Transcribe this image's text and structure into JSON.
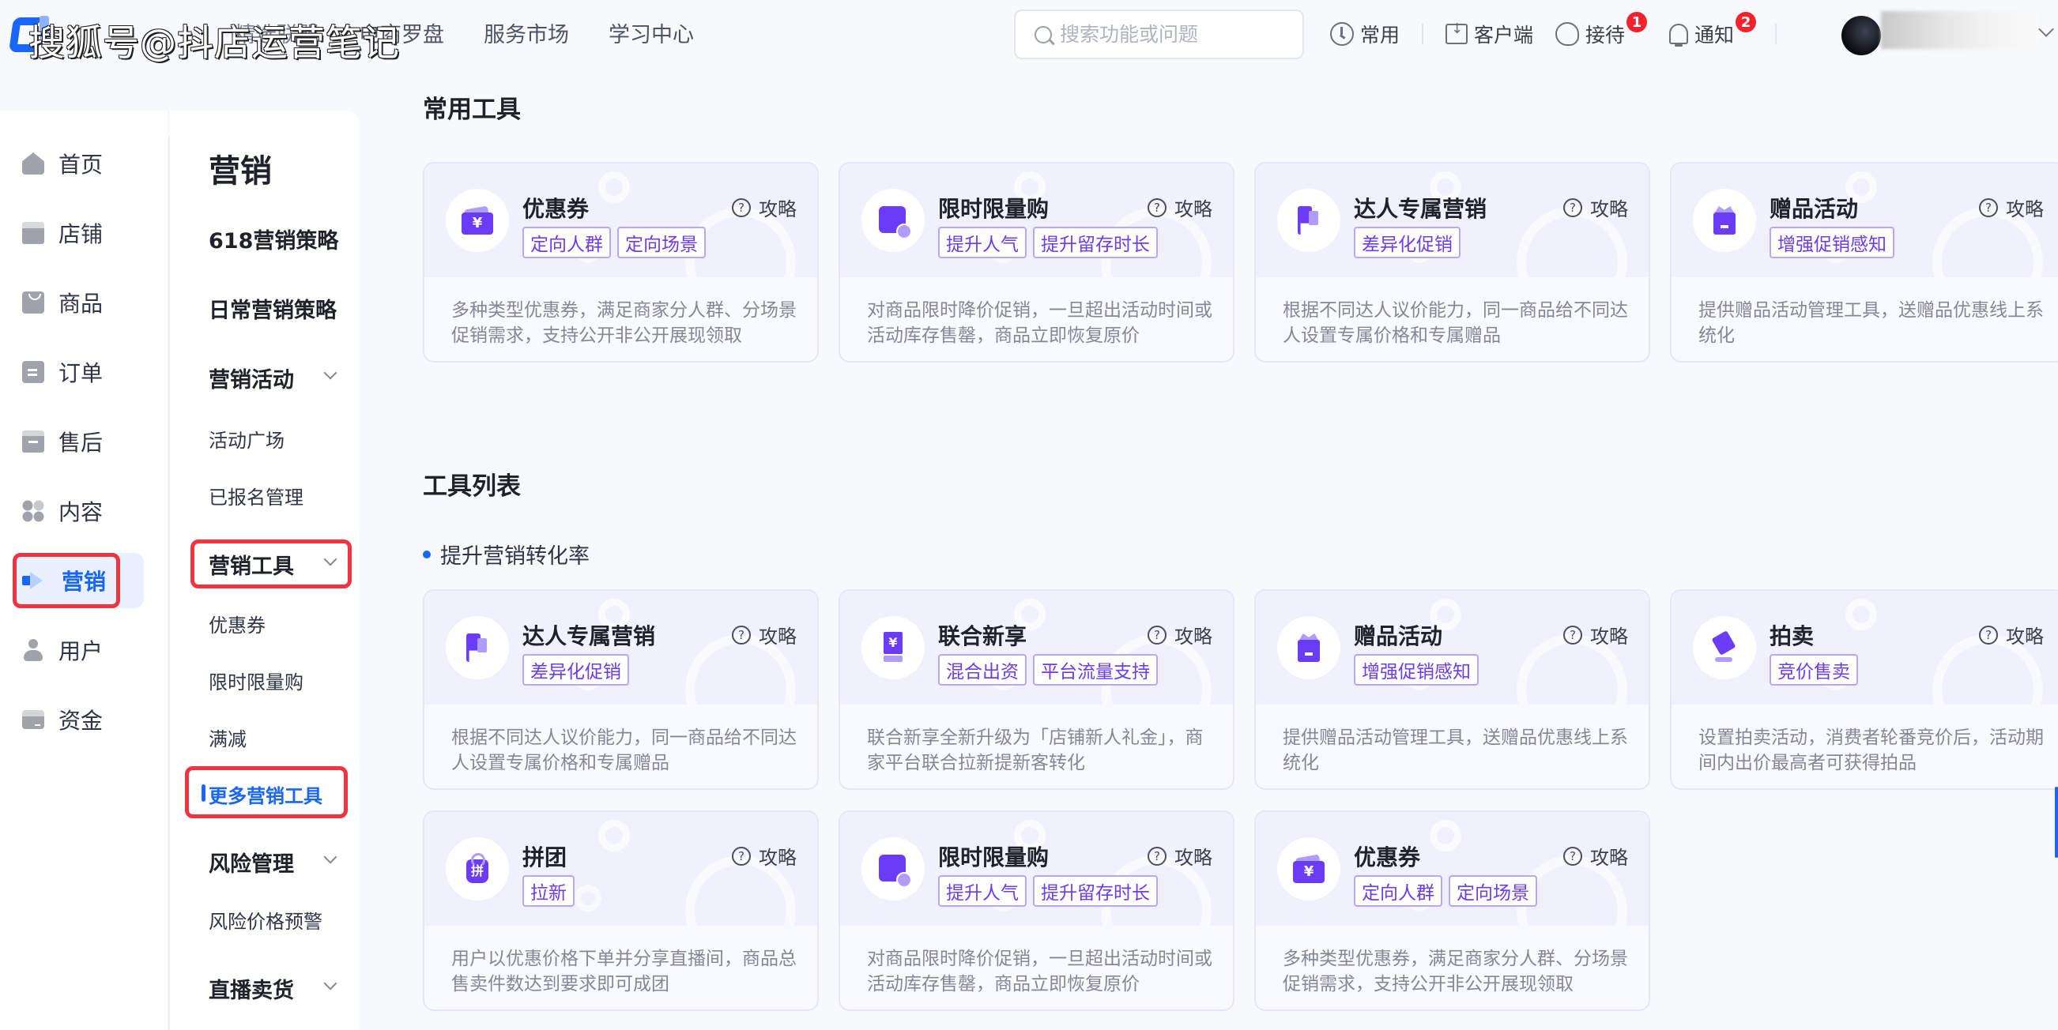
{
  "watermark": "搜狐号@抖店运营笔记",
  "header": {
    "nav": [
      "精选联盟",
      "电商罗盘",
      "服务市场",
      "学习中心"
    ],
    "search_placeholder": "搜索功能或问题",
    "tools": [
      {
        "label": "常用",
        "icon": "clock-icon"
      },
      {
        "label": "客户端",
        "icon": "download-icon"
      },
      {
        "label": "接待",
        "icon": "customer-service-icon",
        "badge": "1"
      },
      {
        "label": "通知",
        "icon": "bell-icon",
        "badge": "2"
      }
    ]
  },
  "sidebar": {
    "items": [
      {
        "label": "首页",
        "icon": "home-icon"
      },
      {
        "label": "店铺",
        "icon": "store-icon"
      },
      {
        "label": "商品",
        "icon": "goods-icon"
      },
      {
        "label": "订单",
        "icon": "order-icon"
      },
      {
        "label": "售后",
        "icon": "after-sales-icon"
      },
      {
        "label": "内容",
        "icon": "content-icon"
      },
      {
        "label": "营销",
        "icon": "megaphone-icon",
        "active": true
      },
      {
        "label": "用户",
        "icon": "user-icon"
      },
      {
        "label": "资金",
        "icon": "wallet-icon"
      }
    ]
  },
  "subnav": {
    "title": "营销",
    "items": {
      "strategy_618": "618营销策略",
      "daily_strategy": "日常营销策略",
      "activities": "营销活动",
      "activity_square": "活动广场",
      "registered": "已报名管理",
      "tools": "营销工具",
      "coupon": "优惠券",
      "flash_sale": "限时限量购",
      "full_reduction": "满减",
      "more_tools": "更多营销工具",
      "risk": "风险管理",
      "risk_price": "风险价格预警",
      "live": "直播卖货"
    }
  },
  "main": {
    "common_title": "常用工具",
    "list_title": "工具列表",
    "list_subtitle": "提升营销转化率",
    "guide_label": "攻略",
    "common_tools": [
      {
        "name": "优惠券",
        "icon": "coupon",
        "tags": [
          "定向人群",
          "定向场景"
        ],
        "desc": "多种类型优惠券，满足商家分人群、分场景促销需求，支持公开非公开展现领取"
      },
      {
        "name": "限时限量购",
        "icon": "bag",
        "tags": [
          "提升人气",
          "提升留存时长"
        ],
        "desc": "对商品限时降价促销，一旦超出活动时间或活动库存售罄，商品立即恢复原价"
      },
      {
        "name": "达人专属营销",
        "icon": "flag",
        "tags": [
          "差异化促销"
        ],
        "desc": "根据不同达人议价能力，同一商品给不同达人设置专属价格和专属赠品"
      },
      {
        "name": "赠品活动",
        "icon": "gift",
        "tags": [
          "增强促销感知"
        ],
        "desc": "提供赠品活动管理工具，送赠品优惠线上系统化"
      }
    ],
    "tool_list": [
      {
        "name": "达人专属营销",
        "icon": "flag",
        "tags": [
          "差异化促销"
        ],
        "desc": "根据不同达人议价能力，同一商品给不同达人设置专属价格和专属赠品"
      },
      {
        "name": "联合新享",
        "icon": "joint",
        "tags": [
          "混合出资",
          "平台流量支持"
        ],
        "desc": "联合新享全新升级为「店铺新人礼金」，商家平台联合拉新提新客转化"
      },
      {
        "name": "赠品活动",
        "icon": "gift",
        "tags": [
          "增强促销感知"
        ],
        "desc": "提供赠品活动管理工具，送赠品优惠线上系统化"
      },
      {
        "name": "拍卖",
        "icon": "gavel",
        "tags": [
          "竞价售卖"
        ],
        "desc": "设置拍卖活动，消费者轮番竞价后，活动期间内出价最高者可获得拍品"
      },
      {
        "name": "拼团",
        "icon": "group",
        "tags": [
          "拉新"
        ],
        "desc": "用户以优惠价格下单并分享直播间，商品总售卖件数达到要求即可成团"
      },
      {
        "name": "限时限量购",
        "icon": "bag",
        "tags": [
          "提升人气",
          "提升留存时长"
        ],
        "desc": "对商品限时降价促销，一旦超出活动时间或活动库存售罄，商品立即恢复原价"
      },
      {
        "name": "优惠券",
        "icon": "coupon",
        "tags": [
          "定向人群",
          "定向场景"
        ],
        "desc": "多种类型优惠券，满足商家分人群、分场景促销需求，支持公开非公开展现领取"
      }
    ]
  },
  "colors": {
    "accent": "#1966ff",
    "tool_purple": "#6a3cf5",
    "highlight_red": "#f0343f",
    "badge_red": "#f5222d"
  }
}
